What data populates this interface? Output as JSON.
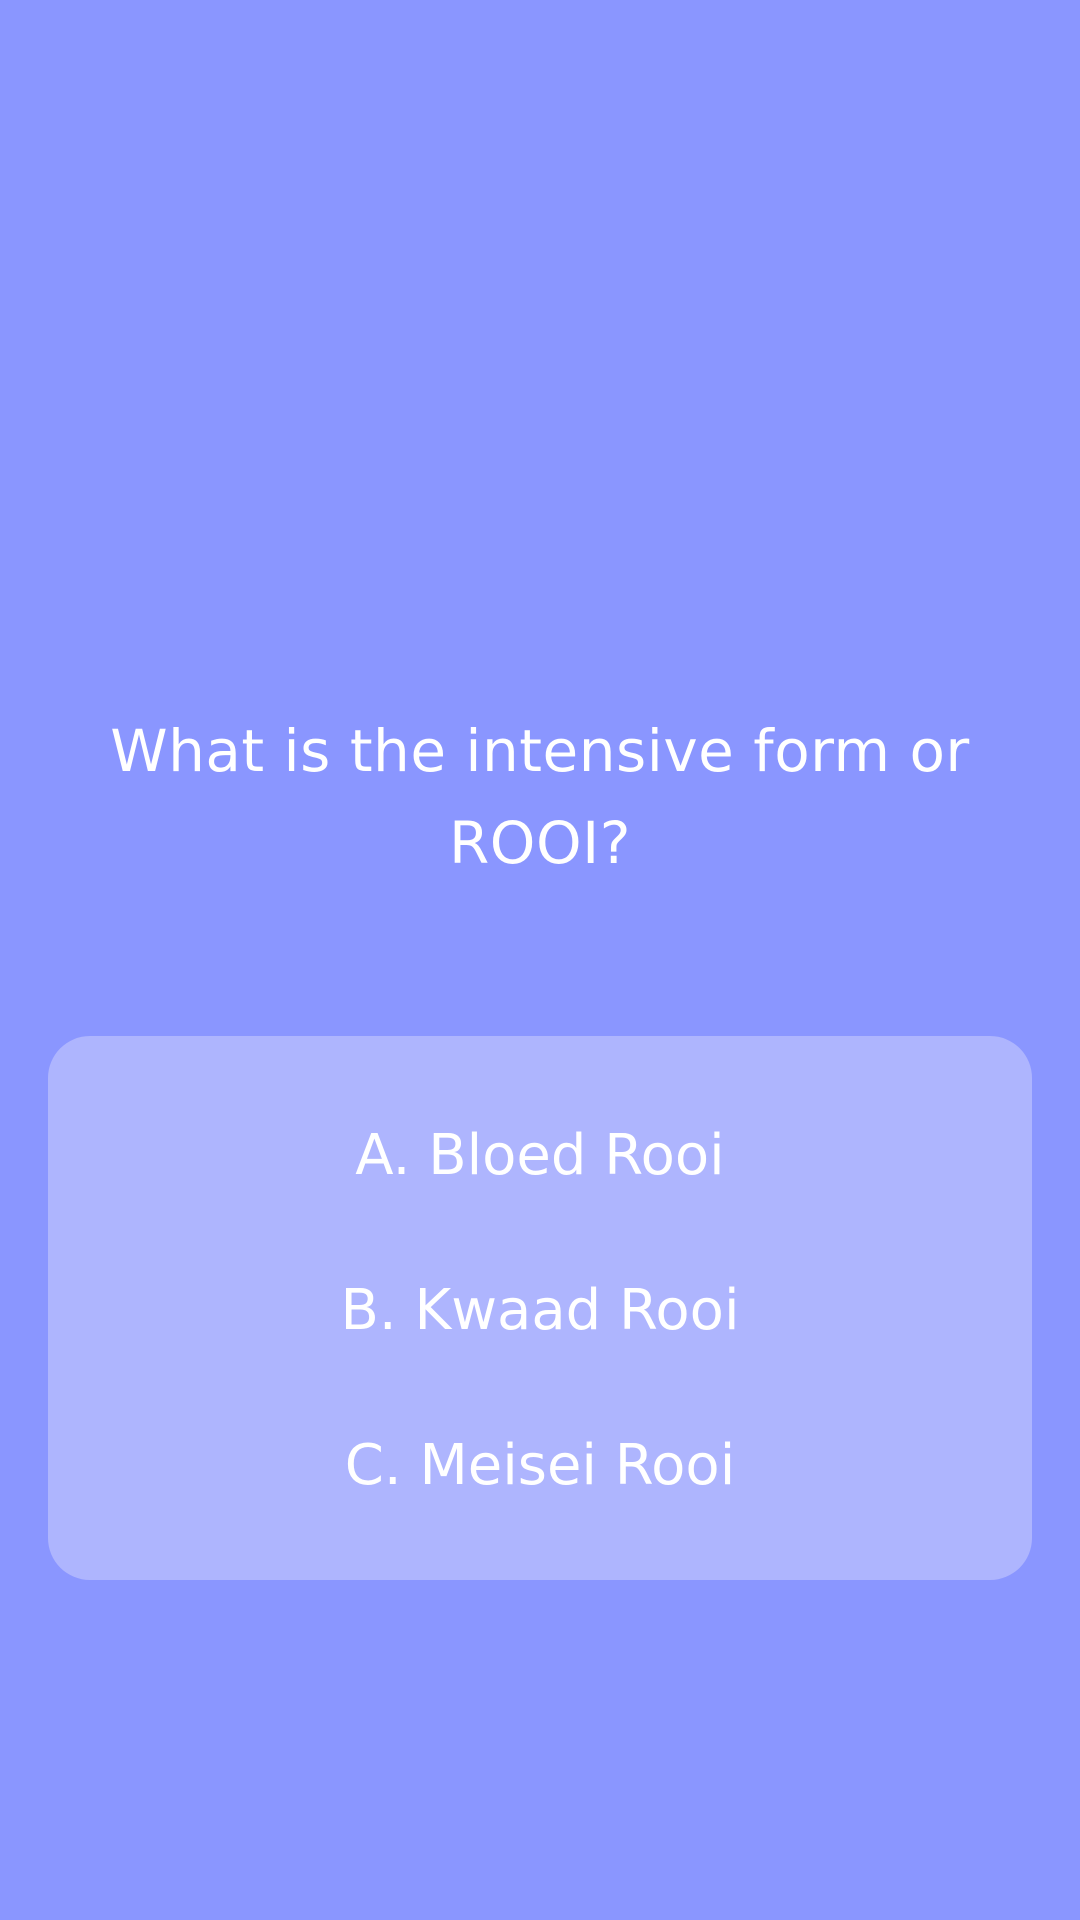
{
  "quiz": {
    "question": "What is the intensive form or ROOI?",
    "answers": [
      {
        "label": "A. Bloed Rooi"
      },
      {
        "label": "B. Kwaad Rooi"
      },
      {
        "label": "C. Meisei Rooi"
      }
    ]
  },
  "colors": {
    "background": "#8a96ff",
    "answer_panel": "#aeb5fe",
    "text": "#ffffff"
  }
}
